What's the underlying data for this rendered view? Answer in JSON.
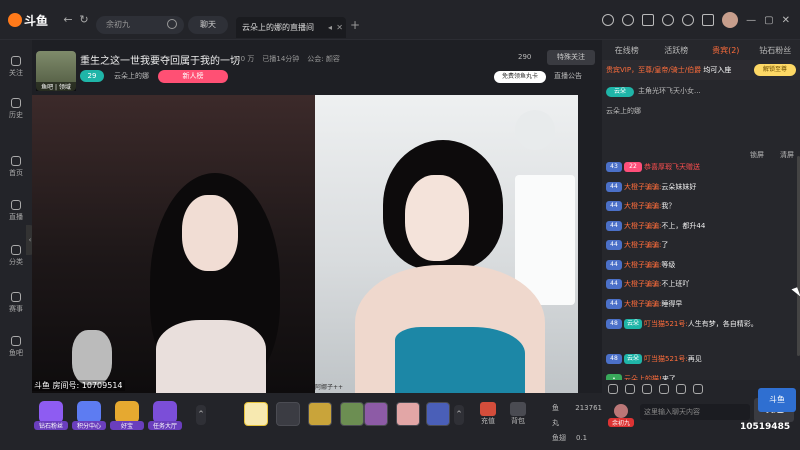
{
  "topbar": {
    "logo_text": "斗鱼",
    "search_placeholder": "余初九",
    "chat_label": "聊天",
    "tab_title": "云朵上的娜的直播间",
    "nav_back": "←",
    "nav_refresh": "↻",
    "add_tab": "+",
    "win_min": "—",
    "win_max": "▢",
    "win_close": "✕"
  },
  "sidebar": {
    "items": [
      {
        "label": "关注",
        "icon": "heart-icon"
      },
      {
        "label": "历史",
        "icon": "clock-icon"
      },
      {
        "label": "首页",
        "icon": "home-icon"
      },
      {
        "label": "直播",
        "icon": "tv-icon"
      },
      {
        "label": "分类",
        "icon": "grid-icon"
      },
      {
        "label": "赛事",
        "icon": "trophy-icon"
      },
      {
        "label": "鱼吧",
        "icon": "fish-icon"
      }
    ],
    "collapse": "‹"
  },
  "stream": {
    "title": "重生之这一世我要夺回属于我的一切",
    "heat": "5.0 万",
    "followers": "已播14分钟",
    "guild": "公会: 颜容",
    "level": "29",
    "streamer_name": "云朵上的娜",
    "new_rank": "新人榜",
    "fans_count": "290",
    "follow_label": "特殊关注",
    "free_gift": "免费领鱼丸卡",
    "announcement": "直播公告",
    "avatar_tag": "鱼吧 | 领域"
  },
  "video": {
    "left_watermark": "斗鱼 房间号: 10709514",
    "right_watermark": "阿娜子++"
  },
  "giftbar": {
    "buttons": [
      {
        "label": "钻石粉丝",
        "color": "#8e5cf2"
      },
      {
        "label": "积分中心",
        "color": "#5d7cf2"
      },
      {
        "label": "好宝",
        "color": "#e6a930"
      },
      {
        "label": "任务大厅",
        "color": "#7b4ed8"
      }
    ],
    "prev": "⌃",
    "next": "⌃",
    "recharge": "充值",
    "bag": "背包",
    "fish_balls_label": "鱼丸",
    "fish_balls": "213761",
    "fish_wings_label": "鱼翅",
    "fish_wings": "0.1"
  },
  "right_panel": {
    "tabs": [
      {
        "label": "在线榜",
        "active": false
      },
      {
        "label": "活跃榜",
        "active": false
      },
      {
        "label": "贵宾(2)",
        "active": true
      },
      {
        "label": "钻石粉丝",
        "active": false
      }
    ],
    "notice_text": "贵宾VIP，至尊/皇帝/骑士/伯爵 ",
    "notice_tail": "均可入座",
    "unlock": "解锁至尊",
    "fan_badge": "云朵",
    "fan_text": "主角光环飞天小女...",
    "room_name": "云朵上的娜",
    "lock_label": "锁屏",
    "clear_label": "清屏",
    "messages": [
      {
        "lv": "43",
        "badge": "22",
        "badge_type": "pink",
        "name": "",
        "text": "恭喜厚瑕飞天赠送",
        "system": true
      },
      {
        "lv": "44",
        "badge": "",
        "name": "大橙子骗骗:",
        "text": "云朵妹妹好"
      },
      {
        "lv": "44",
        "badge": "",
        "name": "大橙子骗骗:",
        "text": "我？"
      },
      {
        "lv": "44",
        "badge": "",
        "name": "大橙子骗骗:",
        "text": "不上，都升44"
      },
      {
        "lv": "44",
        "badge": "",
        "name": "大橙子骗骗:",
        "text": "了"
      },
      {
        "lv": "44",
        "badge": "",
        "name": "大橙子骗骗:",
        "text": "等级"
      },
      {
        "lv": "44",
        "badge": "",
        "name": "大橙子骗骗:",
        "text": "不上班吖"
      },
      {
        "lv": "44",
        "badge": "",
        "name": "大橙子骗骗:",
        "text": "睡得早"
      },
      {
        "lv": "48",
        "badge": "云朵",
        "badge_type": "tl",
        "name": "叮当猫521号:",
        "text": "人生有梦，各自精彩。",
        "wrap": true
      },
      {
        "lv": "48",
        "badge": "云朵",
        "badge_type": "tl",
        "name": "叮当猫521号:",
        "text": "再见"
      },
      {
        "lv": "",
        "badge": "",
        "name": "云朵上的猫!",
        "text": "来了",
        "green": true
      }
    ],
    "input_placeholder": "这里输入聊天内容",
    "user_label": "余初九",
    "send": "发送"
  },
  "overlay": {
    "room_id": "10519485",
    "logo": "斗鱼"
  }
}
